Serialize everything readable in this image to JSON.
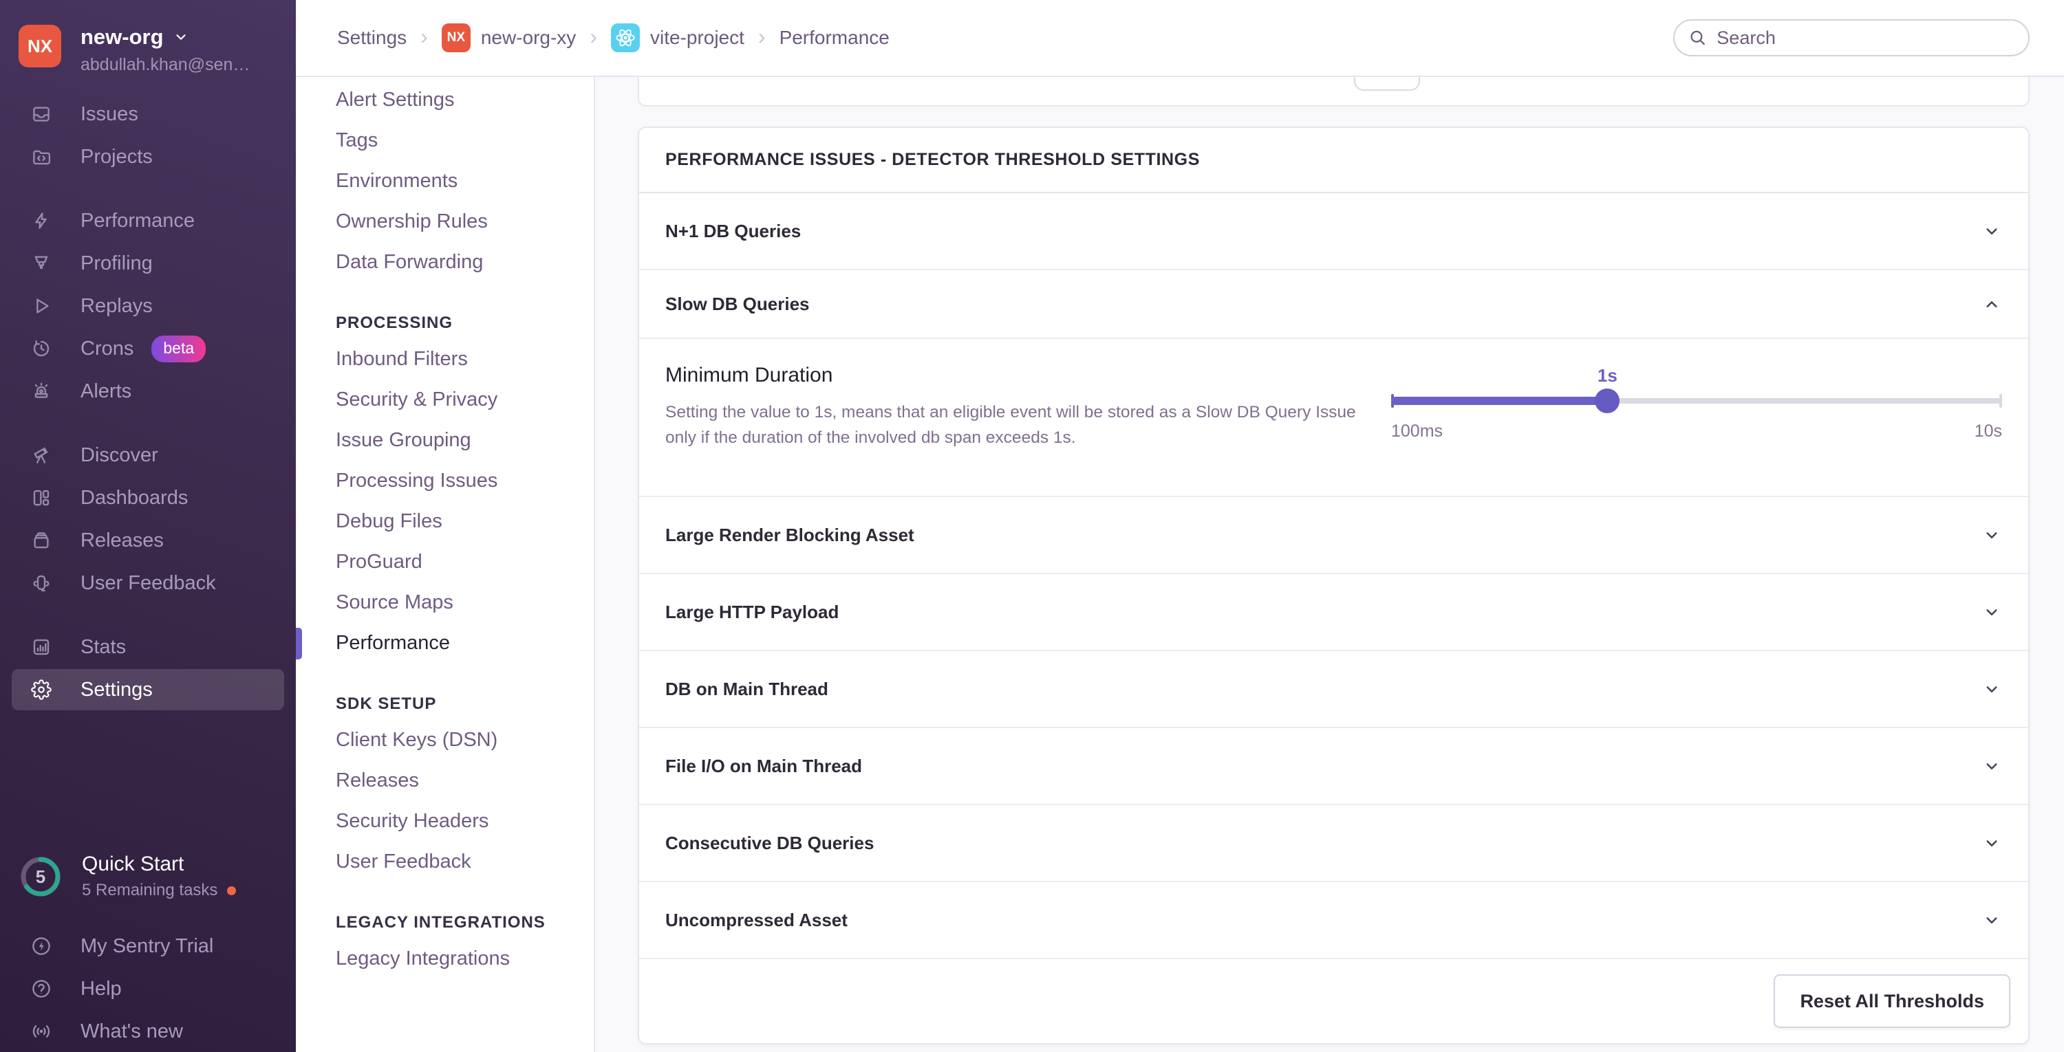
{
  "org": {
    "initials": "NX",
    "name": "new-org",
    "email": "abdullah.khan@sen…"
  },
  "header": {
    "breadcrumbs": [
      {
        "label": "Settings"
      },
      {
        "label": "new-org-xy",
        "badge": "NX"
      },
      {
        "label": "vite-project",
        "icon": "react-icon"
      },
      {
        "label": "Performance"
      }
    ],
    "search_placeholder": "Search"
  },
  "sidebar": {
    "groups": [
      {
        "items": [
          {
            "label": "Issues"
          },
          {
            "label": "Projects"
          }
        ]
      },
      {
        "items": [
          {
            "label": "Performance"
          },
          {
            "label": "Profiling"
          },
          {
            "label": "Replays"
          },
          {
            "label": "Crons",
            "badge": "beta"
          },
          {
            "label": "Alerts"
          }
        ]
      },
      {
        "items": [
          {
            "label": "Discover"
          },
          {
            "label": "Dashboards"
          },
          {
            "label": "Releases"
          },
          {
            "label": "User Feedback"
          }
        ]
      },
      {
        "items": [
          {
            "label": "Stats"
          },
          {
            "label": "Settings"
          }
        ]
      }
    ],
    "active_item": "Settings",
    "quick_start": {
      "title": "Quick Start",
      "subtitle": "5 Remaining tasks",
      "count": "5"
    },
    "footer_items": [
      {
        "label": "My Sentry Trial"
      },
      {
        "label": "Help"
      },
      {
        "label": "What's new"
      }
    ]
  },
  "settings_nav": {
    "active_item": "Performance",
    "groups": [
      {
        "heading": "",
        "items": [
          "Alert Settings",
          "Tags",
          "Environments",
          "Ownership Rules",
          "Data Forwarding"
        ]
      },
      {
        "heading": "PROCESSING",
        "items": [
          "Inbound Filters",
          "Security & Privacy",
          "Issue Grouping",
          "Processing Issues",
          "Debug Files",
          "ProGuard",
          "Source Maps",
          "Performance"
        ]
      },
      {
        "heading": "SDK SETUP",
        "items": [
          "Client Keys (DSN)",
          "Releases",
          "Security Headers",
          "User Feedback"
        ]
      },
      {
        "heading": "LEGACY INTEGRATIONS",
        "items": [
          "Legacy Integrations"
        ]
      }
    ]
  },
  "panel": {
    "title": "PERFORMANCE ISSUES - DETECTOR THRESHOLD SETTINGS",
    "rows": [
      {
        "label": "N+1 DB Queries",
        "state": "collapsed"
      },
      {
        "label": "Slow DB Queries",
        "state": "expanded"
      },
      {
        "label": "Large Render Blocking Asset",
        "state": "collapsed"
      },
      {
        "label": "Large HTTP Payload",
        "state": "collapsed"
      },
      {
        "label": "DB on Main Thread",
        "state": "collapsed"
      },
      {
        "label": "File I/O on Main Thread",
        "state": "collapsed"
      },
      {
        "label": "Consecutive DB Queries",
        "state": "collapsed"
      },
      {
        "label": "Uncompressed Asset",
        "state": "collapsed"
      }
    ],
    "reset_button_label": "Reset All Thresholds"
  },
  "slow_db_detail": {
    "field_label": "Minimum Duration",
    "description": "Setting the value to 1s, means that an eligible event will be stored as a Slow DB Query Issue only if the duration of the involved db span exceeds 1s.",
    "slider": {
      "value_label": "1s",
      "min_label": "100ms",
      "max_label": "10s",
      "percent": 35.4
    }
  },
  "colors": {
    "accent_purple": "#6C5FC7",
    "avatar_orange": "#E8573F",
    "beta_gradient_start": "#7D4BE0",
    "beta_gradient_end": "#EE3A93",
    "ring_teal": "#2EA58C",
    "notice_dot_orange": "#EF6744",
    "react_cyan": "#5AD0F0",
    "sidebar_bg_top": "#483560",
    "sidebar_bg_bottom": "#2F1D3D"
  }
}
